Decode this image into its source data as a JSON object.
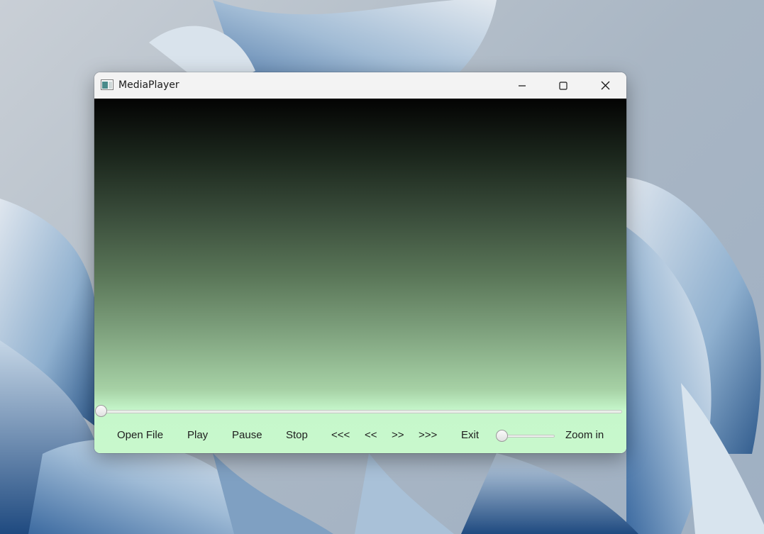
{
  "window": {
    "title": "MediaPlayer",
    "icon": "app-window-icon",
    "caption_buttons": [
      "minimize-icon",
      "maximize-icon",
      "close-icon"
    ]
  },
  "player": {
    "seek_position": 0,
    "zoom_position": 0
  },
  "controls": {
    "open_file": "Open File",
    "play": "Play",
    "pause": "Pause",
    "stop": "Stop",
    "skip_back_far": "<<<",
    "skip_back": "<<",
    "skip_forward": ">>",
    "skip_forward_far": ">>>",
    "exit": "Exit",
    "zoom_in": "Zoom in"
  },
  "colors": {
    "video_top": "#030303",
    "video_bottom": "#c8f8cc",
    "titlebar": "#f3f3f3"
  }
}
